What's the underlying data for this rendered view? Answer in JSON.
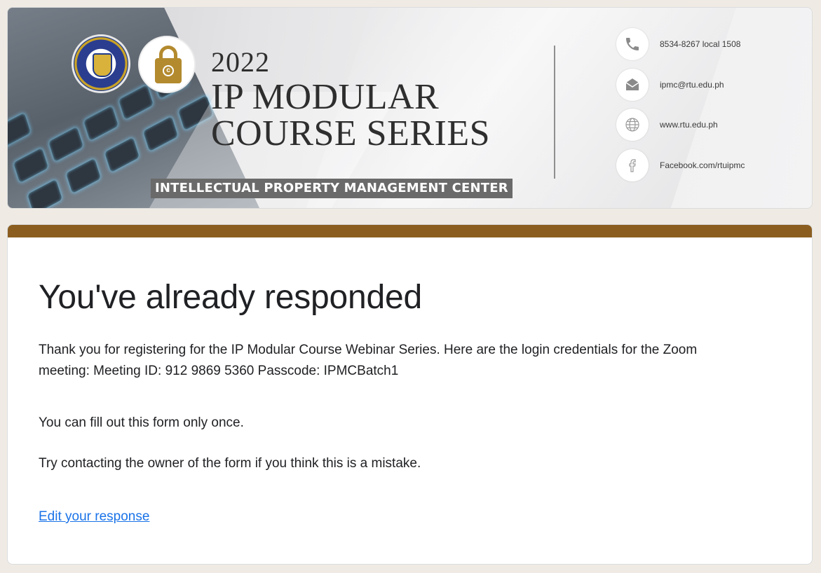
{
  "banner": {
    "year": "2022",
    "title_line1": "IP MODULAR",
    "title_line2": "COURSE SERIES",
    "center_label": "INTELLECTUAL PROPERTY MANAGEMENT CENTER",
    "contacts": [
      {
        "icon": "phone-icon",
        "text": "8534-8267 local 1508"
      },
      {
        "icon": "mail-icon",
        "text": "ipmc@rtu.edu.ph"
      },
      {
        "icon": "globe-icon",
        "text": "www.rtu.edu.ph"
      },
      {
        "icon": "facebook-icon",
        "text": "Facebook.com/rtuipmc"
      }
    ]
  },
  "card": {
    "heading": "You've already responded",
    "message": "Thank you for registering for the IP Modular Course Webinar Series. Here are the login credentials for the Zoom meeting: Meeting ID: 912 9869 5360 Passcode: IPMCBatch1",
    "once_note": "You can fill out this form only once.",
    "contact_note": "Try contacting the owner of the form if you think this is a mistake.",
    "edit_link": "Edit your response"
  },
  "colors": {
    "accent": "#8b5e20",
    "link": "#1a73e8",
    "page_bg": "#efebe4"
  }
}
